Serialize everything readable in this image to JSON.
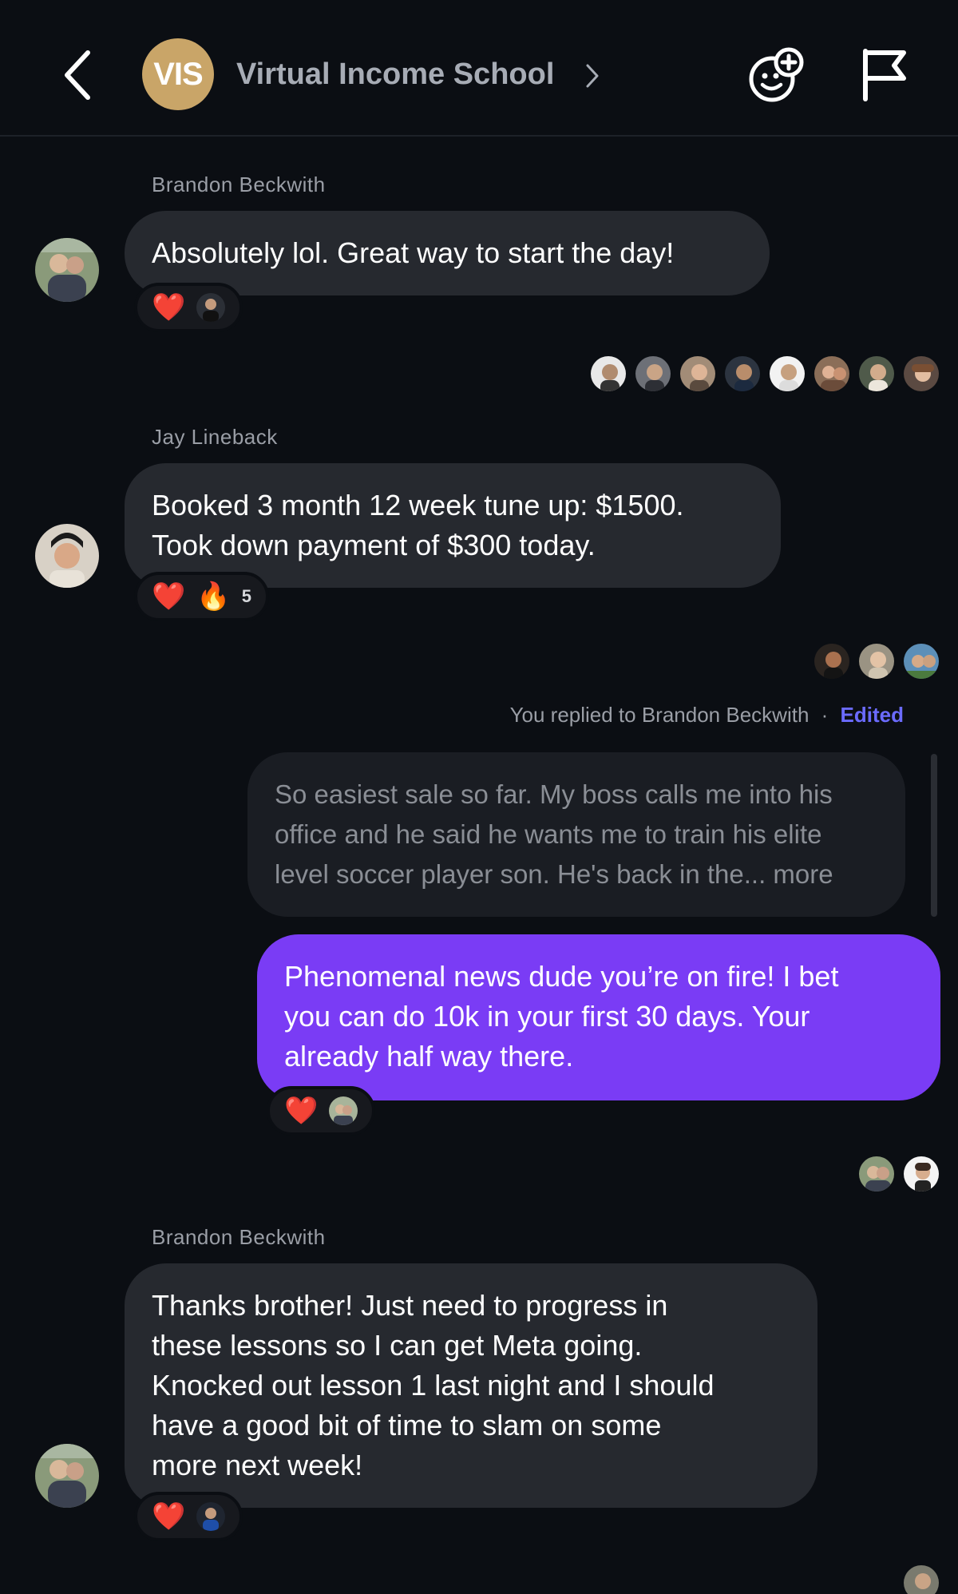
{
  "header": {
    "group_initials": "VIS",
    "group_name": "Virtual Income School"
  },
  "colors": {
    "accent": "#7a3cf5",
    "background": "#0b0e13",
    "bubble_in": "#26292f",
    "edited": "#6b6bff",
    "avatar_gold": "#c9a568"
  },
  "messages": [
    {
      "sender": "Brandon Beckwith",
      "text": "Absolutely lol. Great way to start the day!",
      "reaction": {
        "emoji": "❤️"
      }
    },
    {
      "sender": "Jay Lineback",
      "lines": [
        "Booked 3 month 12 week tune up: $1500.",
        "Took down payment of $300 today."
      ],
      "reaction": {
        "emoji": "❤️",
        "emoji2": "🔥",
        "count": "5"
      }
    },
    {
      "reply_meta": "You replied to Brandon Beckwith",
      "separator": "·",
      "edited": "Edited",
      "quoted_lines": [
        "So easiest sale so far. My boss calls me into his",
        "office and he said he wants me to train his elite",
        "level soccer player son. He's back in the... more"
      ],
      "lines": [
        "Phenomenal news dude you’re on fire! I bet",
        "you can do 10k in your first 30 days. Your",
        "already half way there."
      ],
      "reaction": {
        "emoji": "❤️"
      }
    },
    {
      "sender": "Brandon Beckwith",
      "lines": [
        "Thanks brother! Just need to progress in",
        "these lessons so I can get Meta going.",
        "Knocked out lesson 1 last night and I should",
        "have a good bit of time to slam on some",
        "more next week!"
      ],
      "reaction": {
        "emoji": "❤️"
      }
    }
  ]
}
